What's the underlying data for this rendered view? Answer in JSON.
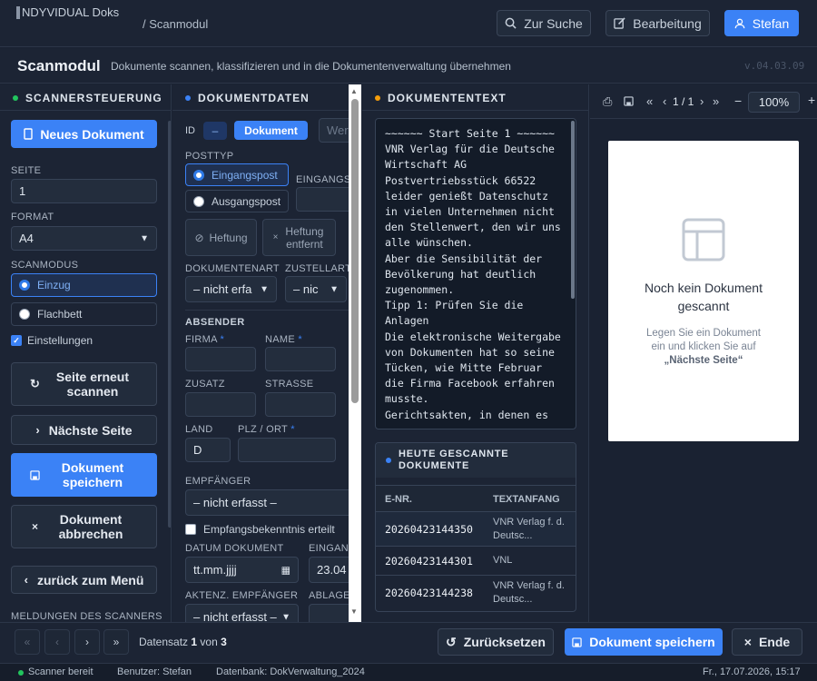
{
  "app": {
    "logo_text": "NDYVIDUAL Doks",
    "breadcrumb": "/ Scanmodul",
    "search_btn": "Zur Suche",
    "edit_btn": "Bearbeitung",
    "user_btn": "Stefan"
  },
  "page": {
    "title": "Scanmodul",
    "subtitle": "Dokumente scannen, klassifizieren und in die Dokumentenverwaltung übernehmen",
    "version": "v.04.03.09"
  },
  "scanner": {
    "heading": "Scannersteuerung",
    "new_doc": "Neues Dokument",
    "seite_label": "SEITE",
    "seite_value": "1",
    "format_label": "FORMAT",
    "format_value": "A4",
    "scanmodus_label": "SCANMODUS",
    "mode_einzug": "Einzug",
    "mode_flachbett": "Flachbett",
    "einstellungen": "Einstellungen",
    "rescan": "Seite erneut scannen",
    "next_page": "Nächste Seite",
    "save_doc": "Dokument speichern",
    "cancel_doc": "Dokument abbrechen",
    "back_menu": "zurück zum Menü",
    "messages_label": "MELDUNGEN DES SCANNERS"
  },
  "docdata": {
    "heading": "Dokumentdaten",
    "id_label": "ID",
    "id_value": "–",
    "doc_badge": "Dokument",
    "wert_placeholder": "Wert",
    "posttyp_label": "POSTTYP",
    "eingangspost": "Eingangspost",
    "ausgangspost": "Ausgangspost",
    "eingangs_label": "EINGANGS",
    "heftung": "Heftung",
    "heftung_entfernt": "Heftung entfernt",
    "dokart_label": "DOKUMENTENART",
    "dokart_value": "– nicht erfa",
    "zustell_label": "ZUSTELLART",
    "zustell_value": "– nic",
    "absender_label": "ABSENDER",
    "firma_label": "FIRMA",
    "name_label": "NAME",
    "zusatz_label": "ZUSATZ",
    "strasse_label": "STRASSE",
    "land_label": "LAND",
    "land_value": "D",
    "plz_label": "PLZ / ORT",
    "empf_label": "EMPFÄNGER",
    "empf_value": "– nicht erfasst –",
    "empfangsbek": "Empfangsbekenntnis erteilt",
    "datum_label": "DATUM DOKUMENT",
    "datum_value": "tt.mm.jjjj",
    "eingang_label": "EINGANG",
    "eingang_value": "23.04",
    "aktenz_label": "AKTENZ. EMPFÄNGER",
    "aktenz_value": "– nicht erfasst –",
    "ablage_label": "ABLAGE",
    "required_mark": "*"
  },
  "doctext": {
    "heading": "Dokumententext",
    "lines": [
      "~~~~~~ Start Seite 1 ~~~~~~",
      "VNR Verlag für die Deutsche",
      "Wirtschaft AG",
      "Postvertriebsstück 66522",
      "leider genießt Datenschutz",
      "in vielen Unternehmen nicht",
      "den Stellenwert, den wir uns",
      "alle wünschen.",
      "Aber die Sensibilität der",
      "Bevölkerung hat deutlich",
      "zugenommen.",
      "Tipp 1: Prüfen Sie die",
      "Anlagen",
      "Die elektronische Weitergabe",
      "von Dokumenten hat so seine",
      "Tücken, wie Mitte Februar",
      "die Firma Facebook erfahren",
      "musste.",
      "Gerichtsakten, in denen es"
    ]
  },
  "today": {
    "heading": "Heute gescannte Dokumente",
    "col_enr": "E-NR.",
    "col_text": "TEXTANFANG",
    "rows": [
      {
        "enr": "20260423144350",
        "text": "VNR Verlag f. d. Deutsc..."
      },
      {
        "enr": "20260423144301",
        "text": "VNL"
      },
      {
        "enr": "20260423144238",
        "text": "VNR Verlag f. d. Deutsc..."
      }
    ]
  },
  "preview": {
    "page_info": "1 / 1",
    "zoom": "100%",
    "empty_title": "Noch kein Dokument gescannt",
    "empty_hint_1": "Legen Sie ein Dokument ein und klicken Sie auf",
    "empty_hint_2": "„Nächste Seite“"
  },
  "footer": {
    "datensatz": "Datensatz",
    "current": "1",
    "von": "von",
    "total": "3",
    "reset": "Zurücksetzen",
    "save": "Dokument speichern",
    "end": "Ende"
  },
  "status": {
    "scanner": "Scanner bereit",
    "user": "Benutzer: Stefan",
    "db": "Datenbank: DokVerwaltung_2024",
    "datetime": "Fr., 17.07.2026, 15:17"
  },
  "colors": {
    "accent": "#3b82f6",
    "ok": "#22c55e",
    "warn": "#f59e0b",
    "bg": "#1a2232"
  }
}
